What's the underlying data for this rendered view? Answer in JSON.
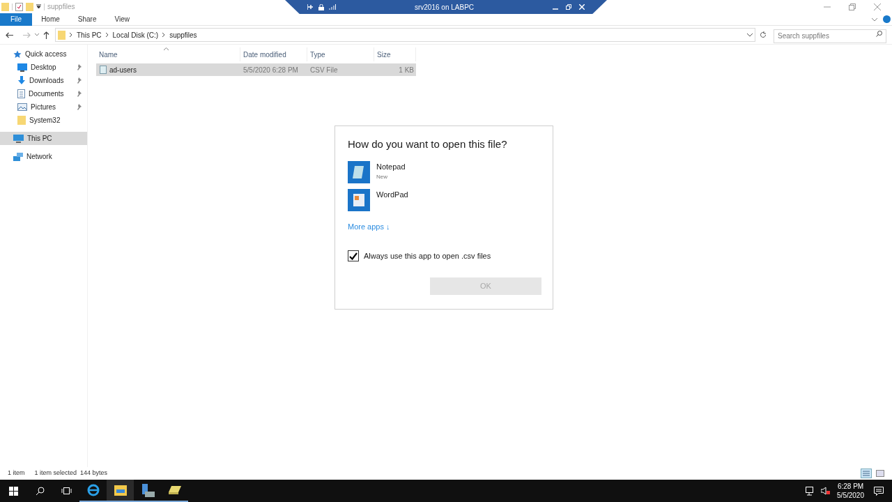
{
  "window": {
    "title": "suppfiles"
  },
  "rdp_bar": {
    "title": "srv2016 on LABPC"
  },
  "ribbon_tabs": [
    {
      "label": "File",
      "selected": true
    },
    {
      "label": "Home",
      "selected": false
    },
    {
      "label": "Share",
      "selected": false
    },
    {
      "label": "View",
      "selected": false
    }
  ],
  "breadcrumb": [
    "This PC",
    "Local Disk (C:)",
    "suppfiles"
  ],
  "search": {
    "placeholder": "Search suppfiles"
  },
  "sidebar": {
    "items": [
      {
        "label": "Quick access",
        "kind": "star",
        "pinned": false,
        "selected": false,
        "children": [
          {
            "label": "Desktop",
            "kind": "desktop",
            "pinned": true,
            "selected": false
          },
          {
            "label": "Downloads",
            "kind": "download",
            "pinned": true,
            "selected": false
          },
          {
            "label": "Documents",
            "kind": "document",
            "pinned": true,
            "selected": false
          },
          {
            "label": "Pictures",
            "kind": "picture",
            "pinned": true,
            "selected": false
          },
          {
            "label": "System32",
            "kind": "folder",
            "pinned": false,
            "selected": false
          }
        ]
      },
      {
        "label": "This PC",
        "kind": "pc",
        "pinned": false,
        "selected": true
      },
      {
        "label": "Network",
        "kind": "network",
        "pinned": false,
        "selected": false
      }
    ]
  },
  "table": {
    "columns": [
      "Name",
      "Date modified",
      "Type",
      "Size"
    ],
    "rows": [
      {
        "name": "ad-users",
        "date": "5/5/2020 6:28 PM",
        "type": "CSV File",
        "size": "1 KB",
        "selected": true
      }
    ]
  },
  "dialog": {
    "title": "How do you want to open this file?",
    "apps": [
      {
        "name": "Notepad",
        "note": "New",
        "kind": "notepad"
      },
      {
        "name": "WordPad",
        "kind": "wordpad"
      }
    ],
    "more_link": "More apps ↓",
    "always_checkbox": {
      "label": "Always use this app to open .csv files",
      "checked": true
    },
    "ok_button": {
      "label": "OK",
      "disabled": true
    }
  },
  "status_bar": [
    "1 item",
    "1 item selected  144 bytes"
  ],
  "taskbar": {
    "time": "6:28 PM",
    "date": "5/5/2020"
  }
}
